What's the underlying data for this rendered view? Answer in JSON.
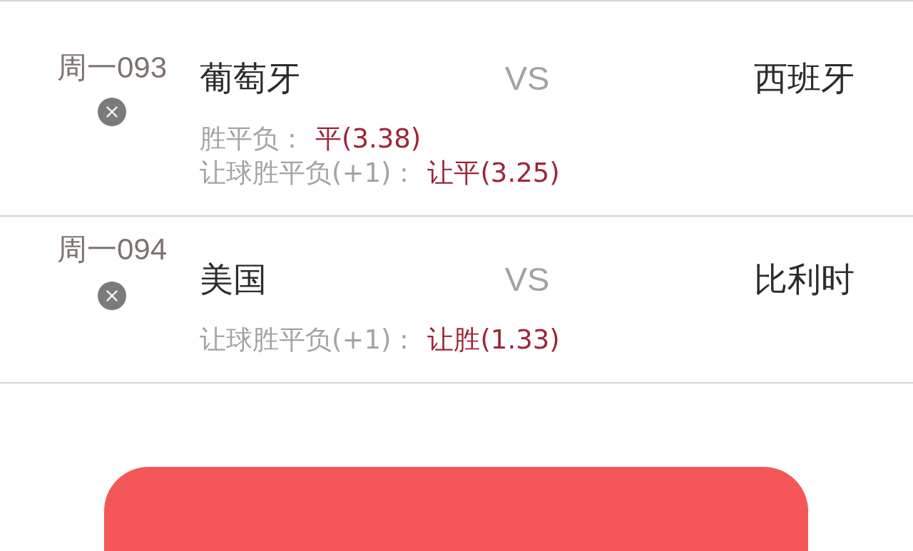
{
  "matches": [
    {
      "code": "周一093",
      "home": "葡萄牙",
      "vs": "VS",
      "away": "西班牙",
      "bets": [
        {
          "label": "胜平负：",
          "pick": "平(3.38)"
        },
        {
          "label": "让球胜平负(+1)：",
          "pick": "让平(3.25)"
        }
      ]
    },
    {
      "code": "周一094",
      "home": "美国",
      "vs": "VS",
      "away": "比利时",
      "bets": [
        {
          "label": "让球胜平负(+1)：",
          "pick": "让胜(1.33)"
        }
      ]
    }
  ],
  "footer_button": {
    "kind": "primary"
  }
}
